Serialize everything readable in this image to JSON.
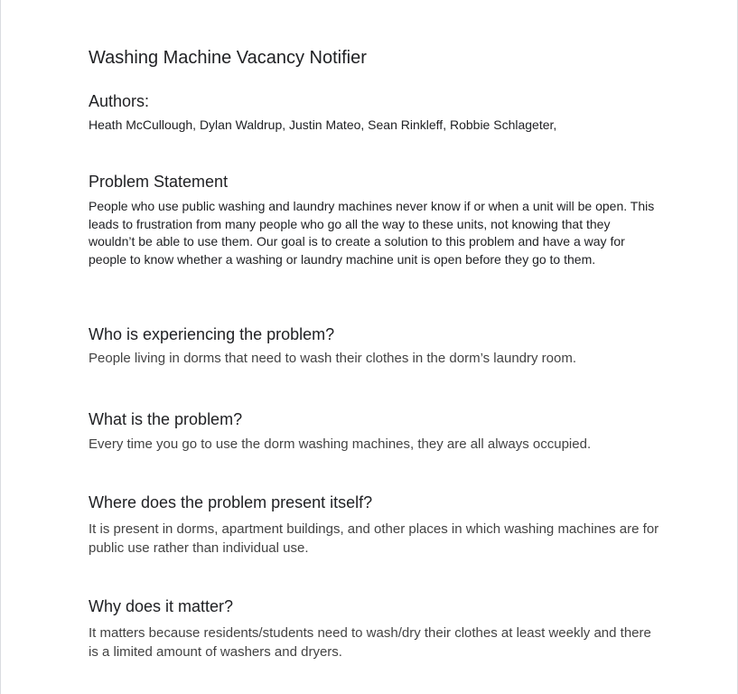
{
  "document": {
    "title": "Washing Machine Vacancy Notifier",
    "authors": {
      "heading": "Authors:",
      "names": "Heath McCullough, Dylan Waldrup, Justin Mateo, Sean Rinkleff, Robbie Schlageter,"
    },
    "sections": [
      {
        "heading": "Problem Statement",
        "text": "People who use public washing and laundry machines never know if or when a unit will be open. This leads to frustration from many people who go all the way to these units, not knowing that they wouldn’t be able to use them. Our goal is to create a solution to this problem and have a way for people to know whether a washing or laundry machine unit is open before they go to them."
      },
      {
        "heading": "Who is experiencing the problem?",
        "text": "People living in dorms that need to wash their clothes in the dorm’s laundry room."
      },
      {
        "heading": "What is the problem?",
        "text": "Every time you go to use the dorm washing machines, they are all always occupied."
      },
      {
        "heading": "Where does the problem present itself?",
        "text": "It is present in dorms, apartment buildings, and other places in which washing machines are for public use rather than individual use."
      },
      {
        "heading": "Why does it matter?",
        "text": "It matters because residents/students need to wash/dry their clothes at least weekly and there is a limited amount of washers and dryers."
      }
    ]
  }
}
